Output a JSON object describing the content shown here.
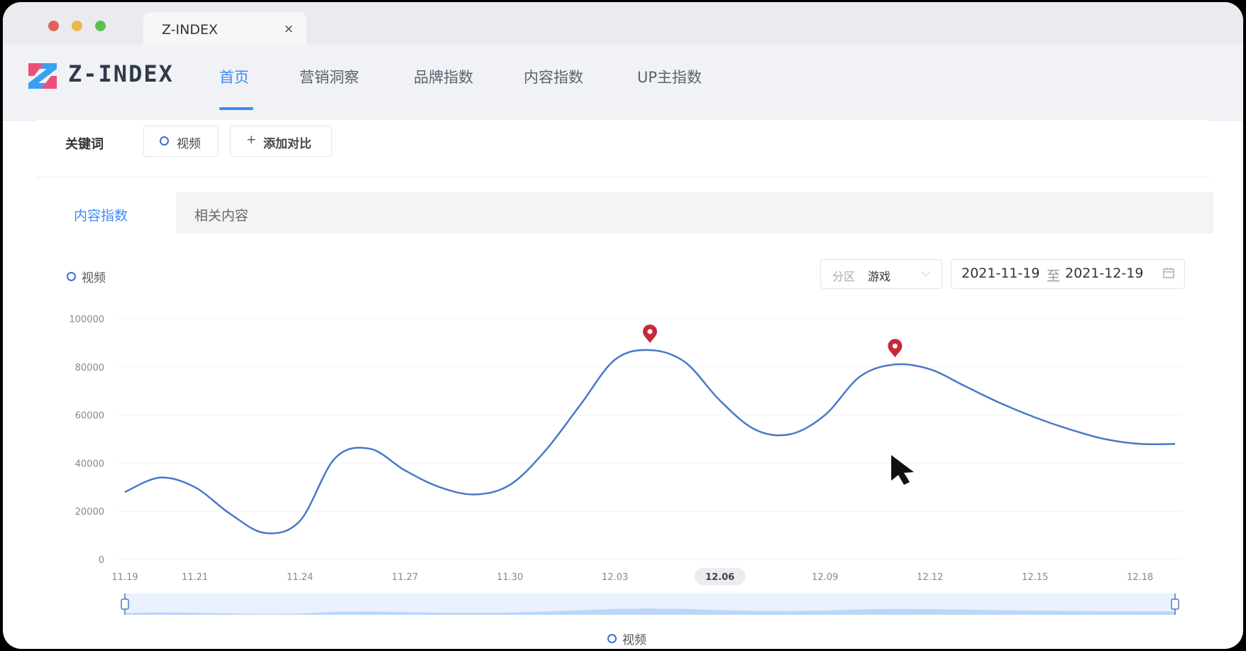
{
  "browser": {
    "tab_title": "Z-INDEX",
    "tab_close": "×"
  },
  "nav": {
    "logo_text": "Z-INDEX",
    "items": [
      {
        "label": "首页",
        "active": true
      },
      {
        "label": "营销洞察",
        "active": false
      },
      {
        "label": "品牌指数",
        "active": false
      },
      {
        "label": "内容指数",
        "active": false
      },
      {
        "label": "UP主指数",
        "active": false
      }
    ]
  },
  "keywords": {
    "label": "关键词",
    "chip": "视频",
    "add_label": "添加对比",
    "add_icon": "+"
  },
  "content_tabs": [
    {
      "label": "内容指数",
      "active": true
    },
    {
      "label": "相关内容",
      "active": false
    }
  ],
  "filters": {
    "category_label": "分区",
    "category_value": "游戏",
    "date_from": "2021-11-19",
    "date_separator": "至",
    "date_to": "2021-12-19"
  },
  "colors": {
    "accent": "#3d8af7",
    "line": "#4a78c8",
    "marker": "#c8283a"
  },
  "chart_data": {
    "type": "line",
    "series": [
      {
        "name": "视频",
        "points": [
          [
            "2021-11-19",
            28000
          ],
          [
            "2021-11-20",
            34000
          ],
          [
            "2021-11-21",
            30000
          ],
          [
            "2021-11-22",
            19000
          ],
          [
            "2021-11-23",
            11000
          ],
          [
            "2021-11-24",
            16000
          ],
          [
            "2021-11-25",
            42000
          ],
          [
            "2021-11-26",
            46000
          ],
          [
            "2021-11-27",
            37000
          ],
          [
            "2021-11-28",
            30000
          ],
          [
            "2021-11-29",
            27000
          ],
          [
            "2021-11-30",
            31000
          ],
          [
            "2021-12-01",
            45000
          ],
          [
            "2021-12-02",
            64000
          ],
          [
            "2021-12-03",
            83000
          ],
          [
            "2021-12-04",
            87000
          ],
          [
            "2021-12-05",
            82000
          ],
          [
            "2021-12-06",
            66000
          ],
          [
            "2021-12-07",
            54000
          ],
          [
            "2021-12-08",
            52000
          ],
          [
            "2021-12-09",
            60000
          ],
          [
            "2021-12-10",
            76000
          ],
          [
            "2021-12-11",
            81000
          ],
          [
            "2021-12-12",
            79000
          ],
          [
            "2021-12-13",
            72000
          ],
          [
            "2021-12-14",
            65000
          ],
          [
            "2021-12-15",
            59000
          ],
          [
            "2021-12-16",
            54000
          ],
          [
            "2021-12-17",
            50000
          ],
          [
            "2021-12-18",
            48000
          ],
          [
            "2021-12-19",
            48000
          ]
        ]
      }
    ],
    "ylim": [
      0,
      100000
    ],
    "yticks": [
      "100000",
      "80000",
      "60000",
      "40000",
      "20000",
      "0"
    ],
    "xticks": [
      "11.19",
      "11.21",
      "11.24",
      "11.27",
      "11.30",
      "12.03",
      "12.06",
      "12.09",
      "12.12",
      "12.15",
      "12.18"
    ],
    "highlighted_xtick": "12.06",
    "markers": [
      {
        "x": "2021-12-04",
        "y": 87000
      },
      {
        "x": "2021-12-11",
        "y": 81000
      }
    ],
    "grid": "horizontal",
    "legend": "top-left and bottom-center",
    "legend_label": "视频",
    "zoom_range": [
      0,
      1
    ]
  }
}
